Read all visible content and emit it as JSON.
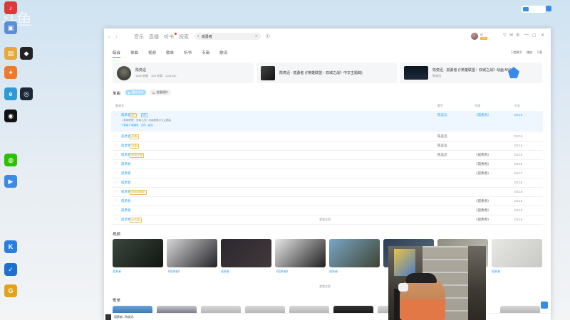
{
  "desktop": {
    "watermark": "斗鱼",
    "tray": {
      "badge": "",
      "items": [
        "",
        ""
      ]
    },
    "icons": [
      {
        "name": "app-icon-red",
        "color": "#d93b3b",
        "glyph": "♪",
        "label": ""
      },
      {
        "name": "app-icon-pc",
        "color": "#5a8fd6",
        "glyph": "▣",
        "label": ""
      },
      {
        "name": "app-icon-folder",
        "color": "#e6a83c",
        "glyph": "▤",
        "label": ""
      },
      {
        "name": "app-icon-ue",
        "color": "#222222",
        "glyph": "◆",
        "label": ""
      },
      {
        "name": "app-icon-fire",
        "color": "#f07a2a",
        "glyph": "✦",
        "label": ""
      },
      {
        "name": "app-icon-edge",
        "color": "#2e9ad6",
        "glyph": "e",
        "label": ""
      },
      {
        "name": "app-icon-steam",
        "color": "#1b2838",
        "glyph": "◎",
        "label": ""
      },
      {
        "name": "app-icon-qq",
        "color": "#111111",
        "glyph": "◉",
        "label": ""
      },
      {
        "name": "app-icon-wechat",
        "color": "#2dc100",
        "glyph": "◍",
        "label": ""
      },
      {
        "name": "app-icon-video",
        "color": "#3a8be8",
        "glyph": "▶",
        "label": ""
      },
      {
        "name": "app-icon-kugou",
        "color": "#2a7de1",
        "glyph": "K",
        "label": ""
      },
      {
        "name": "app-icon-task",
        "color": "#1f6fd1",
        "glyph": "✓",
        "label": ""
      },
      {
        "name": "app-icon-game",
        "color": "#e3a21a",
        "glyph": "G",
        "label": ""
      }
    ]
  },
  "window": {
    "nav": [
      {
        "label": "音乐",
        "active": false
      },
      {
        "label": "直播",
        "active": false
      },
      {
        "label": "听书",
        "active": false
      },
      {
        "label": "探索",
        "active": false
      }
    ],
    "search": {
      "value": "孤勇者",
      "clear": "✕"
    },
    "user": {
      "name": "ID",
      "vip": "VIP"
    },
    "controls": [
      "▽",
      "✉",
      "⚙",
      "—",
      "▢",
      "✕"
    ]
  },
  "tabs": [
    {
      "label": "综合",
      "active": true
    },
    {
      "label": "单曲",
      "active": false
    },
    {
      "label": "视频",
      "active": false
    },
    {
      "label": "歌单",
      "active": false
    },
    {
      "label": "听书",
      "active": false
    },
    {
      "label": "专辑",
      "active": false
    },
    {
      "label": "歌词",
      "active": false
    }
  ],
  "top_right_links": [
    "只看歌手",
    "播放",
    "下载"
  ],
  "top_cards": [
    {
      "title": "陈奕迅",
      "sub": "",
      "stats": [
        "1580 单曲",
        "128 专辑",
        "1144 MV"
      ]
    },
    {
      "title": "陈奕迅 - 孤勇者 (《英雄联盟：双城之战》中文主题曲)",
      "sub": ""
    },
    {
      "title": "陈奕迅 - 孤勇者 (《英雄联盟：双城之战》动画 MV)",
      "sub": "陈奕迅"
    }
  ],
  "songs_section": {
    "label": "单曲",
    "pill_on": "播放全部",
    "pill_off": "批量操作",
    "headers": {
      "title": "歌曲名",
      "artist": "歌手",
      "album": "专辑",
      "duration": "时长"
    },
    "rows": [
      {
        "title": "孤勇者",
        "tags": [
          "VIP",
          "MV"
        ],
        "artist": "陈奕迅",
        "album": "《孤勇者》",
        "duration": "04:16",
        "highlight": true,
        "sub1": "《英雄联盟：双城之战》动画剧集中文主题曲",
        "sub2": "下载客户端播放 · 无损 · 高品"
      },
      {
        "title": "孤勇者",
        "tags": [
          "(伴奏)"
        ],
        "artist": "陈奕迅",
        "album": "",
        "duration": "04:16",
        "highlight": false
      },
      {
        "title": "孤勇者",
        "tags": [
          "(伴奏)"
        ],
        "artist": "陈奕迅",
        "album": "",
        "duration": "04:16",
        "highlight": false
      },
      {
        "title": "孤勇者",
        "tags": [
          "(男版合唱)"
        ],
        "artist": "陈奕迅",
        "album": "《孤勇者》",
        "duration": "04:16",
        "highlight": false
      },
      {
        "title": "孤勇者",
        "tags": [],
        "artist": "",
        "album": "《孤勇者》",
        "duration": "04:16",
        "highlight": false
      },
      {
        "title": "孤勇者",
        "tags": [],
        "artist": "",
        "album": "《孤勇者》",
        "duration": "04:17",
        "highlight": false
      },
      {
        "title": "孤勇者",
        "tags": [],
        "artist": "",
        "album": "",
        "duration": "04:16",
        "highlight": false
      },
      {
        "title": "孤勇者",
        "tags": [
          "(男版深情版)"
        ],
        "artist": "",
        "album": "",
        "duration": "04:16",
        "highlight": false
      },
      {
        "title": "孤勇者",
        "tags": [],
        "artist": "",
        "album": "《孤勇者》",
        "duration": "04:16",
        "highlight": false
      },
      {
        "title": "孤勇者",
        "tags": [],
        "artist": "",
        "album": "《孤勇者》",
        "duration": "04:16",
        "highlight": false
      },
      {
        "title": "孤勇者",
        "tags": [
          "(女生版)"
        ],
        "artist": "",
        "album": "《孤勇者》",
        "duration": "04:16",
        "highlight": false
      }
    ],
    "more": "查看全部"
  },
  "video_section": {
    "label": "视频",
    "items": [
      {
        "cap_pre": "",
        "cap_hl": "孤勇者",
        "cap_post": "",
        "src": "",
        "colors": [
          "#3a4740",
          "#11150f"
        ]
      },
      {
        "cap_pre": "《",
        "cap_hl": "孤勇者",
        "cap_post": "》",
        "src": "",
        "colors": [
          "#d8d8d8",
          "#222228"
        ]
      },
      {
        "cap_pre": "",
        "cap_hl": "孤勇者",
        "cap_post": "",
        "src": "",
        "colors": [
          "#2a2930",
          "#43373a"
        ]
      },
      {
        "cap_pre": "《",
        "cap_hl": "孤勇者",
        "cap_post": "》",
        "src": "",
        "colors": [
          "#e8e8e8",
          "#1e1e1e"
        ]
      },
      {
        "cap_pre": "",
        "cap_hl": "孤勇者",
        "cap_post": "",
        "src": "",
        "colors": [
          "#79a7c6",
          "#3f4433"
        ]
      },
      {
        "cap_pre": "",
        "cap_hl": "",
        "cap_post": "",
        "src": "",
        "colors": [
          "#2b3e56",
          "#5b6b79"
        ]
      },
      {
        "cap_pre": "",
        "cap_hl": "",
        "cap_post": "",
        "src": "",
        "colors": [
          "#8d8a7f",
          "#c9c6bd"
        ]
      },
      {
        "cap_pre": "",
        "cap_hl": "孤勇者",
        "cap_post": "",
        "src": "",
        "colors": [
          "#e7e7e5",
          "#c8c8c4"
        ]
      }
    ],
    "more": "查看全部"
  },
  "playlist_section": {
    "label": "歌单"
  },
  "player": {
    "title": "孤勇者 - 陈奕迅"
  }
}
